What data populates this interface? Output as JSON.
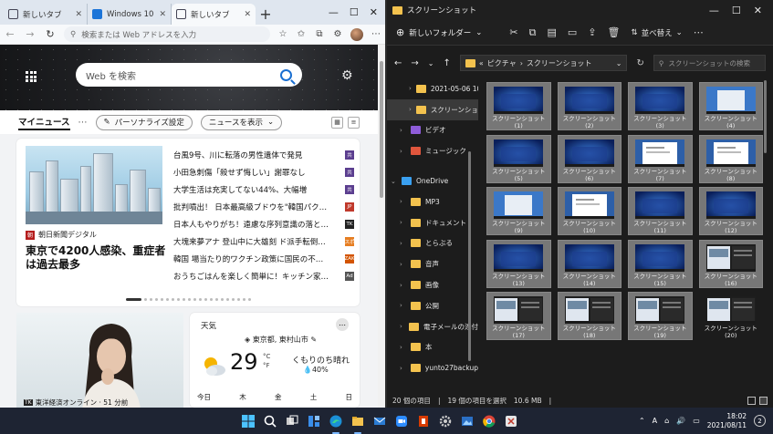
{
  "browser": {
    "tabs": [
      {
        "label": "新しいタブ",
        "icon": "page-icon"
      },
      {
        "label": "Windows 10",
        "icon": "windows-icon"
      },
      {
        "label": "新しいタブ",
        "icon": "page-icon"
      }
    ],
    "address_placeholder": "検索または Web アドレスを入力",
    "hero": {
      "search_placeholder": "Web を検索"
    },
    "newsbar": {
      "my_news": "マイニュース",
      "personalize": "パーソナライズ設定",
      "show_news": "ニュースを表示"
    },
    "feature": {
      "source": "朝日新聞デジタル",
      "headline": "東京で4200人感染、重症者は過去最多"
    },
    "headlines": [
      {
        "text": "台風9号、川に転落の男性遺体で発見",
        "badge": "共",
        "color": "#5b3e8f"
      },
      {
        "text": "小田急刺傷「殺せず悔しい」謝罪なし",
        "badge": "共",
        "color": "#5b3e8f"
      },
      {
        "text": "大学生活は充実してない44%、大幅増",
        "badge": "共",
        "color": "#5b3e8f"
      },
      {
        "text": "批判噴出！ 日本最高級ブドウを\"韓国パク…",
        "badge": "JP",
        "color": "#c0392b"
      },
      {
        "text": "日本人もやりがち！遠慮な序列意識の落と…",
        "badge": "TK",
        "color": "#222222"
      },
      {
        "text": "大塊来夢アナ 登山中に大雄刻 ド派手転倒…",
        "badge": "スポ",
        "color": "#e67e22"
      },
      {
        "text": "韓国 場当たり的ワクチン政策に国民の不…",
        "badge": "ZAK",
        "color": "#d35400"
      },
      {
        "text": "おうちごはんを楽しく簡単に！キッチン家…",
        "badge": "Ad",
        "color": "#555555"
      }
    ],
    "woman_card": {
      "source": "東洋経済オンライン · 51 分前",
      "logo": "TK"
    },
    "weather": {
      "title": "天気",
      "location": "東京都, 東村山市",
      "temp": "29",
      "unit_c": "°C",
      "unit_f": "°F",
      "desc": "くもりのち晴れ",
      "rain": "40%",
      "days": [
        "今日",
        "木",
        "金",
        "土",
        "日"
      ]
    }
  },
  "explorer": {
    "title": "スクリーンショット",
    "new_folder": "新しいフォルダー",
    "sort": "並べ替え",
    "path": [
      "ピクチャ",
      "スクリーンショット"
    ],
    "path_prefix": "«",
    "search_placeholder": "スクリーンショットの検索",
    "nav": [
      {
        "label": "2021-05-06 10.4",
        "indent": 2,
        "color": "#f3c24e",
        "sel": false
      },
      {
        "label": "スクリーンショット",
        "indent": 2,
        "color": "#f3c24e",
        "sel": true
      },
      {
        "label": "ビデオ",
        "indent": 1,
        "color": "#8e5cd9",
        "sel": false
      },
      {
        "label": "ミュージック",
        "indent": 1,
        "color": "#e0563d",
        "sel": false
      },
      {
        "label": "",
        "indent": 0,
        "color": "",
        "sel": false
      },
      {
        "label": "OneDrive",
        "indent": 0,
        "color": "#3aa0f0",
        "sel": false,
        "expanded": true
      },
      {
        "label": "MP3",
        "indent": 1,
        "color": "#f3c24e",
        "sel": false
      },
      {
        "label": "ドキュメント",
        "indent": 1,
        "color": "#f3c24e",
        "sel": false
      },
      {
        "label": "とらぶる",
        "indent": 1,
        "color": "#f3c24e",
        "sel": false
      },
      {
        "label": "音声",
        "indent": 1,
        "color": "#f3c24e",
        "sel": false
      },
      {
        "label": "画像",
        "indent": 1,
        "color": "#f3c24e",
        "sel": false
      },
      {
        "label": "公開",
        "indent": 1,
        "color": "#f3c24e",
        "sel": false
      },
      {
        "label": "電子メールの添付",
        "indent": 1,
        "color": "#f3c24e",
        "sel": false
      },
      {
        "label": "本",
        "indent": 1,
        "color": "#f3c24e",
        "sel": false
      },
      {
        "label": "yunto27backup",
        "indent": 1,
        "color": "#f3c24e",
        "sel": false
      },
      {
        "label": "",
        "indent": 0,
        "color": "",
        "sel": false
      },
      {
        "label": "PC",
        "indent": 0,
        "color": "#3aa0f0",
        "sel": false
      },
      {
        "label": "",
        "indent": 0,
        "color": "",
        "sel": false
      },
      {
        "label": "ネットワーク",
        "indent": 0,
        "color": "#3aa0f0",
        "sel": false
      }
    ],
    "files": [
      {
        "name": "スクリーンショット",
        "num": "(1)",
        "sel": true,
        "style": "win11"
      },
      {
        "name": "スクリーンショット",
        "num": "(2)",
        "sel": true,
        "style": "win11"
      },
      {
        "name": "スクリーンショット",
        "num": "(3)",
        "sel": true,
        "style": "win11"
      },
      {
        "name": "スクリーンショット",
        "num": "(4)",
        "sel": true,
        "style": "light"
      },
      {
        "name": "スクリーンショット",
        "num": "(5)",
        "sel": true,
        "style": "win11"
      },
      {
        "name": "スクリーンショット",
        "num": "(6)",
        "sel": true,
        "style": "win11"
      },
      {
        "name": "スクリーンショット",
        "num": "(7)",
        "sel": true,
        "style": "white"
      },
      {
        "name": "スクリーンショット",
        "num": "(8)",
        "sel": true,
        "style": "white"
      },
      {
        "name": "スクリーンショット",
        "num": "(9)",
        "sel": true,
        "style": "light"
      },
      {
        "name": "スクリーンショット",
        "num": "(10)",
        "sel": true,
        "style": "white"
      },
      {
        "name": "スクリーンショット",
        "num": "(11)",
        "sel": true,
        "style": "win11"
      },
      {
        "name": "スクリーンショット",
        "num": "(12)",
        "sel": true,
        "style": "win11"
      },
      {
        "name": "スクリーンショット",
        "num": "(13)",
        "sel": true,
        "style": "win11"
      },
      {
        "name": "スクリーンショット",
        "num": "(14)",
        "sel": true,
        "style": "win11"
      },
      {
        "name": "スクリーンショット",
        "num": "(15)",
        "sel": true,
        "style": "win11"
      },
      {
        "name": "スクリーンショット",
        "num": "(16)",
        "sel": true,
        "style": "split"
      },
      {
        "name": "スクリーンショット",
        "num": "(17)",
        "sel": true,
        "style": "split"
      },
      {
        "name": "スクリーンショット",
        "num": "(18)",
        "sel": true,
        "style": "split"
      },
      {
        "name": "スクリーンショット",
        "num": "(19)",
        "sel": true,
        "style": "split"
      },
      {
        "name": "スクリーンショット",
        "num": "(20)",
        "sel": false,
        "style": "split"
      }
    ],
    "status": {
      "count": "20 個の項目",
      "selected": "19 個の項目を選択",
      "size": "10.6 MB"
    }
  },
  "taskbar": {
    "apps": [
      {
        "icon": "windows-start-icon",
        "active": false
      },
      {
        "icon": "search-icon",
        "active": false
      },
      {
        "icon": "task-view-icon",
        "active": false
      },
      {
        "icon": "widgets-icon",
        "active": false
      },
      {
        "icon": "edge-icon",
        "active": true
      },
      {
        "icon": "file-explorer-icon",
        "active": true
      },
      {
        "icon": "mail-icon",
        "active": false
      },
      {
        "icon": "zoom-icon",
        "active": false
      },
      {
        "icon": "office-icon",
        "active": false
      },
      {
        "icon": "settings-icon",
        "active": false
      },
      {
        "icon": "photos-icon",
        "active": false
      },
      {
        "icon": "chrome-icon",
        "active": false
      },
      {
        "icon": "snipping-icon",
        "active": false
      }
    ],
    "ime": "A",
    "time": "18:02",
    "date": "2021/08/11",
    "notifications": "2"
  },
  "colors": {
    "accent": "#1a6fd1",
    "explorer_bg": "#1c1c1c",
    "taskbar_bg": "#1e2433",
    "folder": "#f3c24e"
  }
}
